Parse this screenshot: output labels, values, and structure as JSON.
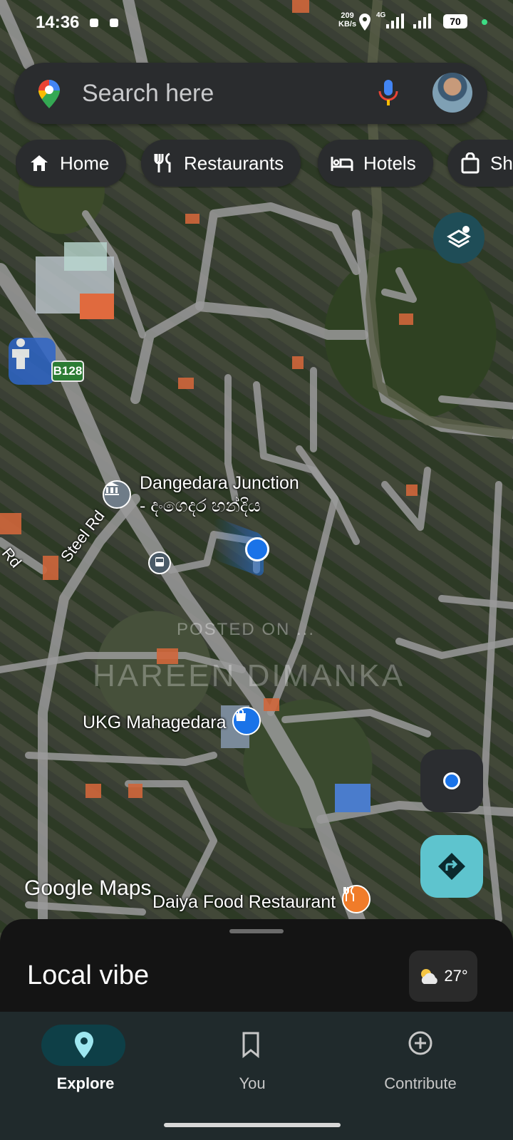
{
  "status_bar": {
    "time": "14:36",
    "speed": "209",
    "speed_unit": "KB/s",
    "network": "4G",
    "battery": "70"
  },
  "search": {
    "placeholder": "Search here",
    "icons": [
      "maps-pin-icon",
      "mic-icon",
      "avatar"
    ]
  },
  "chips": [
    {
      "label": "Home",
      "icon": "home-icon"
    },
    {
      "label": "Restaurants",
      "icon": "fork-knife-icon"
    },
    {
      "label": "Hotels",
      "icon": "bed-icon"
    },
    {
      "label": "Sh",
      "icon": "shopping-bag-icon"
    }
  ],
  "map": {
    "route_shield": "B128",
    "labels": {
      "junction_line1": "Dangedara Junction",
      "junction_line2": "- දංගෙදර හන්දිය",
      "steel_rd": "Steel Rd",
      "rd": "Rd",
      "ukg": "UKG Mahagedara",
      "daiya": "Daiya Food Restaurant"
    },
    "logo": "Google Maps",
    "watermark_line1": "POSTED ON ...",
    "watermark_line2": "HAREEN DIMANKA"
  },
  "sheet": {
    "title": "Local vibe",
    "temperature": "27°"
  },
  "nav": [
    {
      "label": "Explore",
      "icon": "location-pin-icon",
      "active": true
    },
    {
      "label": "You",
      "icon": "bookmark-icon",
      "active": false
    },
    {
      "label": "Contribute",
      "icon": "add-circle-icon",
      "active": false
    }
  ],
  "colors": {
    "accent": "#1a73e8",
    "directions": "#5ec4ce",
    "nav_active_pill": "#0e3f47",
    "nav_active_icon": "#9ee7f0"
  }
}
